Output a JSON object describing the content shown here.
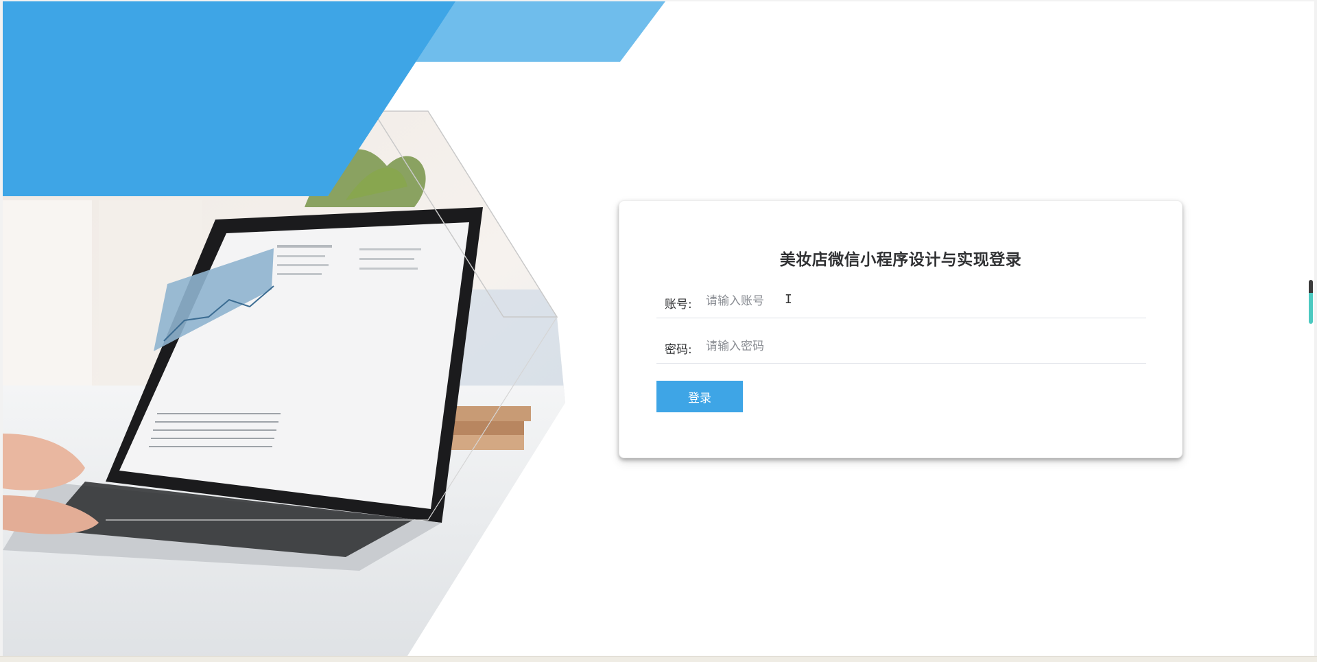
{
  "login": {
    "title": "美妆店微信小程序设计与实现登录",
    "account_label": "账号:",
    "account_placeholder": "请输入账号",
    "password_label": "密码:",
    "password_placeholder": "请输入密码",
    "button_label": "登录"
  },
  "colors": {
    "accent": "#3ea5e6",
    "accent_light": "#6fbdec",
    "card_bg": "#ffffff",
    "page_bg": "#ffffff"
  },
  "icons": {
    "cursor": "text-cursor-icon",
    "scroll": "scroll-indicator"
  }
}
